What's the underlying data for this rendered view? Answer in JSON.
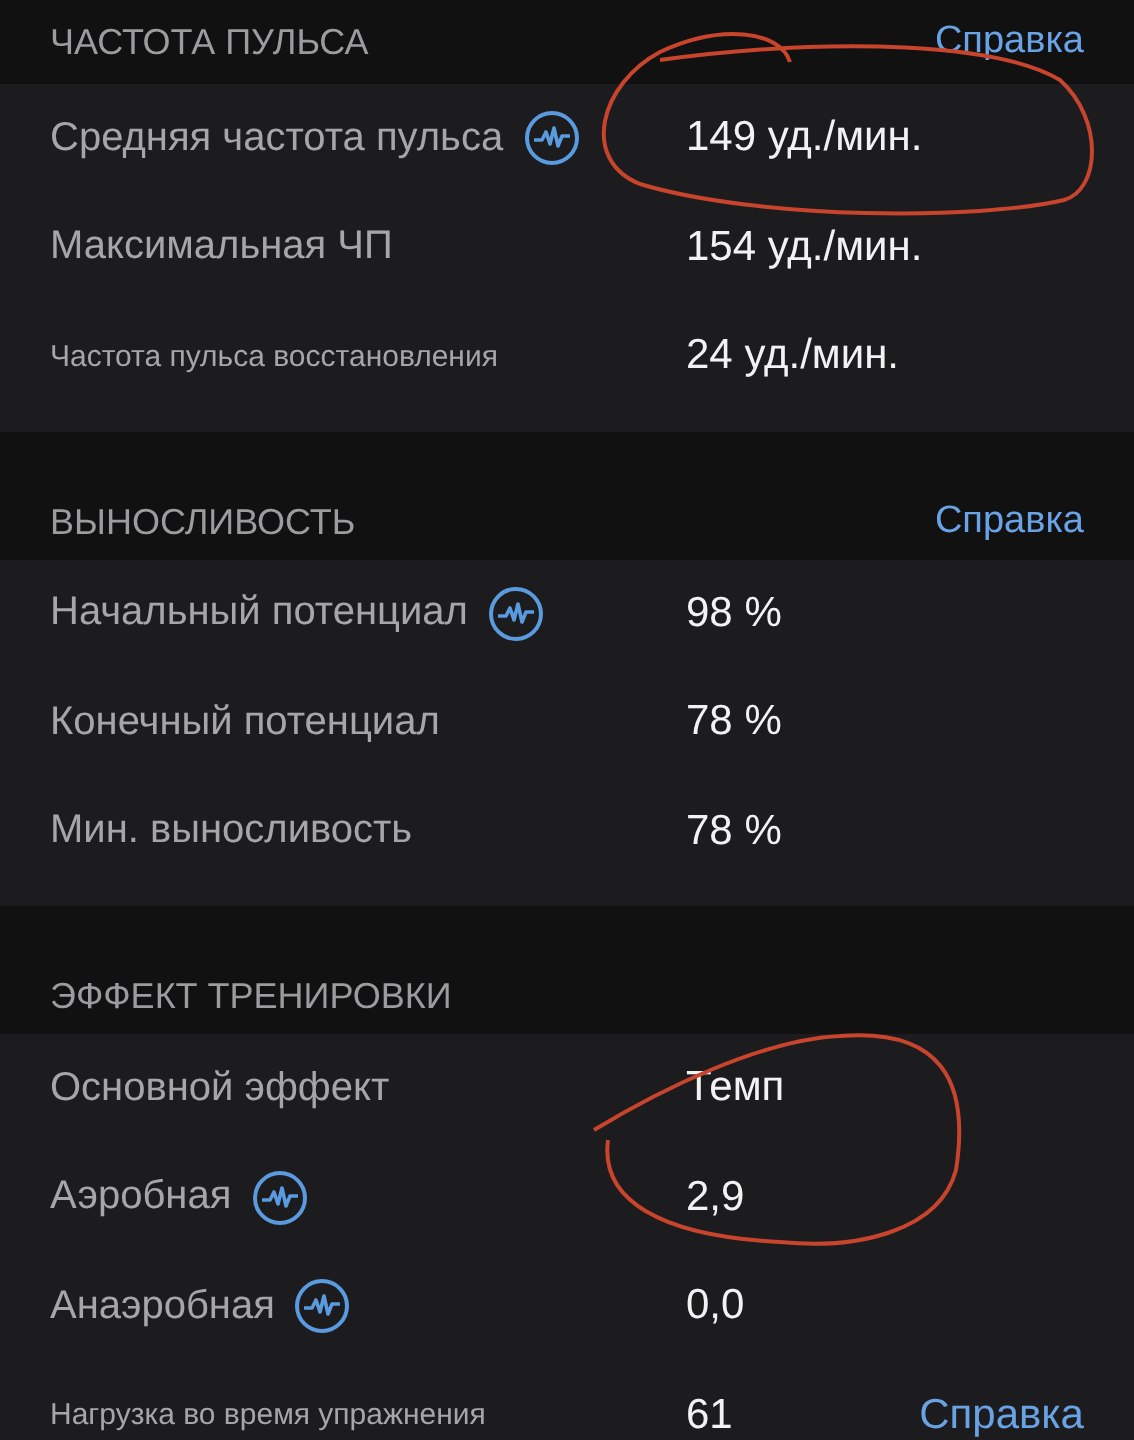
{
  "sections": [
    {
      "title": "ЧАСТОТА ПУЛЬСА",
      "help_link": "Справка",
      "rows": [
        {
          "label": "Средняя частота пульса",
          "kind": "normal",
          "has_icon": true,
          "value": "149 уд./мин."
        },
        {
          "label": "Максимальная ЧП",
          "kind": "normal",
          "has_icon": false,
          "value": "154 уд./мин."
        },
        {
          "label": "Частота пульса восстановления",
          "kind": "small",
          "has_icon": false,
          "value": "24 уд./мин."
        }
      ]
    },
    {
      "title": "ВЫНОСЛИВОСТЬ",
      "help_link": "Справка",
      "rows": [
        {
          "label": "Начальный потенциал",
          "kind": "normal",
          "has_icon": true,
          "value": "98 %"
        },
        {
          "label": "Конечный потенциал",
          "kind": "normal",
          "has_icon": false,
          "value": "78 %"
        },
        {
          "label": "Мин. выносливость",
          "kind": "normal",
          "has_icon": false,
          "value": "78 %"
        }
      ]
    },
    {
      "title": "ЭФФЕКТ ТРЕНИРОВКИ",
      "rows": [
        {
          "label": "Основной эффект",
          "kind": "normal",
          "has_icon": false,
          "value": "Темп"
        },
        {
          "label": "Аэробная",
          "kind": "normal",
          "has_icon": true,
          "value": "2,9"
        },
        {
          "label": "Анаэробная",
          "kind": "normal",
          "has_icon": true,
          "value": "0,0"
        },
        {
          "label": "Нагрузка во время упражнения",
          "kind": "small",
          "has_icon": false,
          "value": "61",
          "help_link": "Справка"
        }
      ]
    }
  ]
}
